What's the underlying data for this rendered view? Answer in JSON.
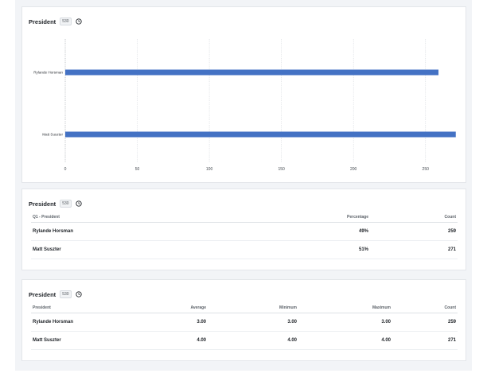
{
  "chart_card": {
    "title": "President",
    "badge": "530",
    "clock_icon": "clock-icon"
  },
  "chart_data": {
    "type": "bar",
    "orientation": "horizontal",
    "categories": [
      "Rylande Horsman",
      "Matt Suszter"
    ],
    "values": [
      259,
      271
    ],
    "xlim": [
      0,
      275
    ],
    "xticks": [
      0,
      50,
      100,
      150,
      200,
      250
    ],
    "grid": true,
    "bar_color": "#4472c4"
  },
  "percentage_table": {
    "title": "President",
    "badge": "530",
    "columns": [
      "Q1 - President",
      "Percentage",
      "Count"
    ],
    "rows": [
      [
        "Rylande Horsman",
        "49%",
        "259"
      ],
      [
        "Matt Suszter",
        "51%",
        "271"
      ]
    ]
  },
  "stats_table": {
    "title": "President",
    "badge": "530",
    "columns": [
      "President",
      "Average",
      "Minimum",
      "Maximum",
      "Count"
    ],
    "rows": [
      [
        "Rylande Horsman",
        "3.00",
        "3.00",
        "3.00",
        "259"
      ],
      [
        "Matt Suszter",
        "4.00",
        "4.00",
        "4.00",
        "271"
      ]
    ]
  }
}
